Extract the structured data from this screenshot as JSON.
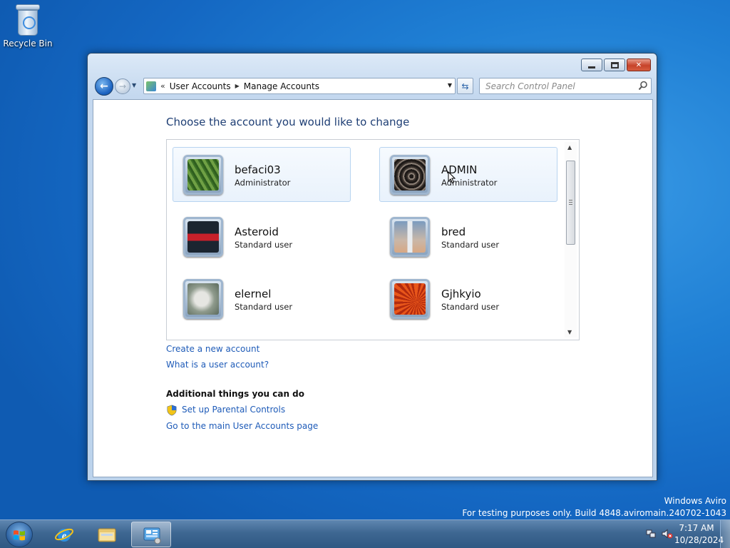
{
  "desktop": {
    "recycle_bin_label": "Recycle Bin"
  },
  "window": {
    "address": {
      "overflow_chevron": "«",
      "part1": "User Accounts",
      "part2": "Manage Accounts"
    },
    "search_placeholder": "Search Control Panel",
    "content": {
      "title": "Choose the account you would like to change",
      "accounts": [
        {
          "name": "befaci03",
          "role": "Administrator",
          "picture": "green-leaf",
          "selected": true
        },
        {
          "name": "ADMIN",
          "role": "Administrator",
          "picture": "spiral-staircase",
          "selected": true
        },
        {
          "name": "Asteroid",
          "role": "Standard user",
          "picture": "red-car",
          "selected": false
        },
        {
          "name": "bred",
          "role": "Standard user",
          "picture": "lighthouse",
          "selected": false
        },
        {
          "name": "elernel",
          "role": "Standard user",
          "picture": "snowy-rock",
          "selected": false
        },
        {
          "name": "Gjhkyio",
          "role": "Standard user",
          "picture": "orange-flower",
          "selected": false
        }
      ],
      "links": {
        "create_account": "Create a new account",
        "what_is_account": "What is a user account?"
      },
      "additional_heading": "Additional things you can do",
      "additional_links": {
        "parental_controls": "Set up Parental Controls",
        "main_page": "Go to the main User Accounts page"
      }
    }
  },
  "watermark": {
    "line1": "Windows Aviro",
    "line2": "For testing purposes only. Build 4848.aviromain.240702-1043"
  },
  "taskbar": {
    "pinned": [
      "windows-start",
      "internet-explorer",
      "windows-explorer",
      "control-panel"
    ],
    "active": "control-panel",
    "clock_time": "7:17 AM",
    "clock_date": "10/28/2024"
  },
  "colors": {
    "title_text": "#1e3e74",
    "link": "#1e5bb8",
    "desktop_blue": "#1f7fd4"
  }
}
